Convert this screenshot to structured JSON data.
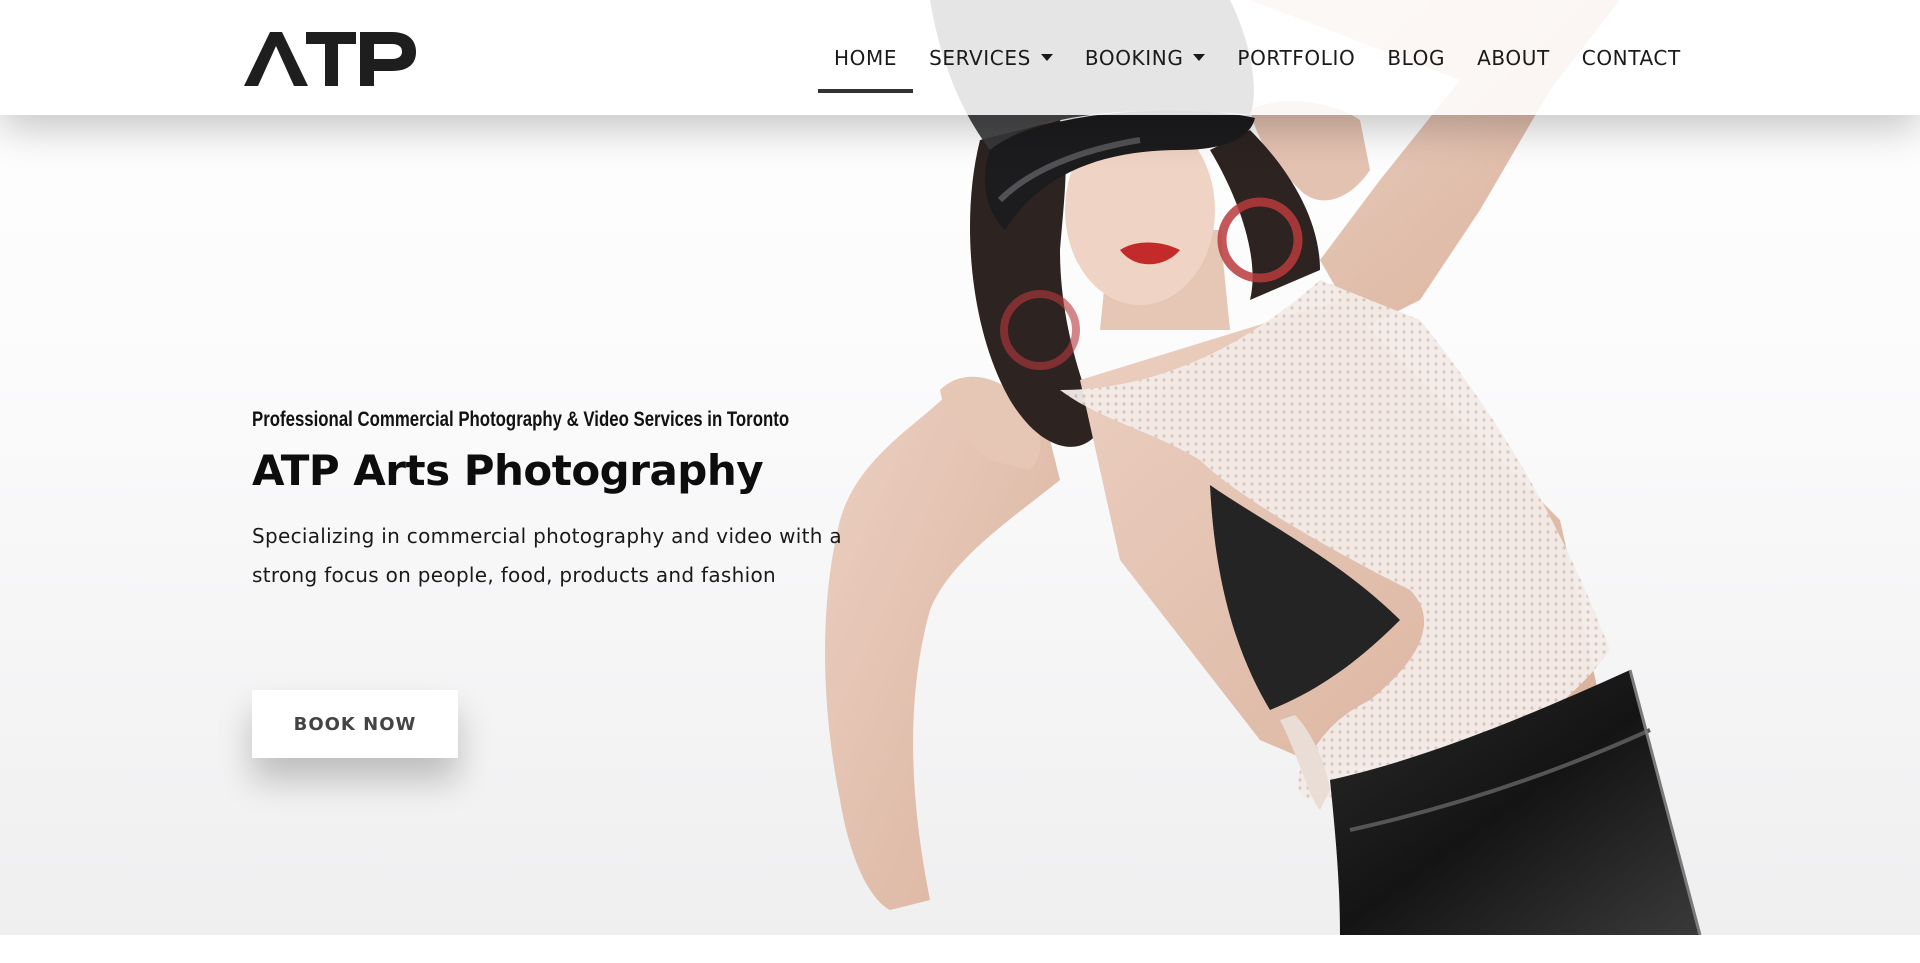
{
  "header": {
    "logo_text": "ATP",
    "nav": [
      {
        "label": "HOME",
        "active": true,
        "dropdown": false
      },
      {
        "label": "SERVICES",
        "active": false,
        "dropdown": true
      },
      {
        "label": "BOOKING",
        "active": false,
        "dropdown": true
      },
      {
        "label": "PORTFOLIO",
        "active": false,
        "dropdown": false
      },
      {
        "label": "BLOG",
        "active": false,
        "dropdown": false
      },
      {
        "label": "ABOUT",
        "active": false,
        "dropdown": false
      },
      {
        "label": "CONTACT",
        "active": false,
        "dropdown": false
      }
    ]
  },
  "hero": {
    "tagline": "Professional Commercial Photography & Video Services in Toronto",
    "title": "ATP Arts Photography",
    "description": "Specializing in commercial photography and video with a strong focus on people, food, products and fashion",
    "cta_label": "BOOK NOW"
  },
  "colors": {
    "text": "#111111",
    "nav_underline": "#333333",
    "button_bg": "#ffffff",
    "button_text": "#444444"
  },
  "icons": {
    "dropdown": "caret-down-icon"
  }
}
